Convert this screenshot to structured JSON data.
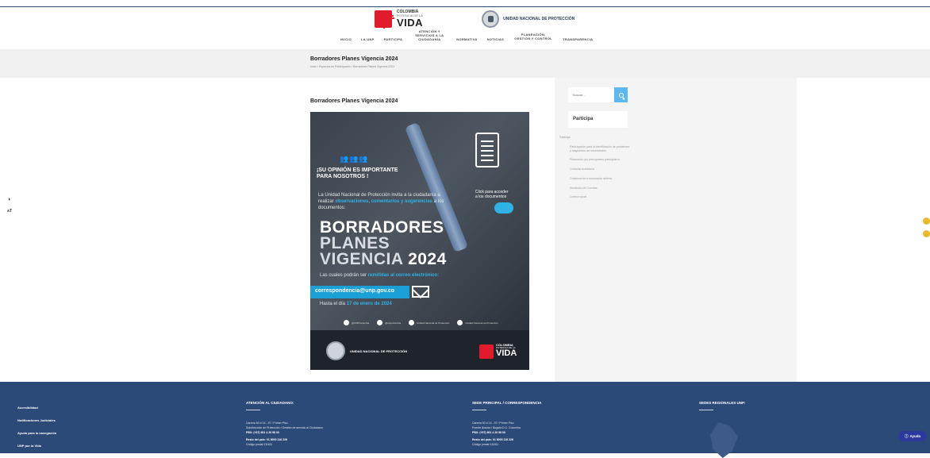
{
  "header": {
    "colombia_logo": {
      "line1": "COLOMBIA",
      "line2": "POTENCIA DE LA",
      "line3": "VIDA"
    },
    "unp_logo": {
      "text": "UNIDAD NACIONAL DE PROTECCIÓN"
    },
    "nav": [
      {
        "label": "INICIO"
      },
      {
        "label": "LA UNP"
      },
      {
        "label": "PARTICIPA"
      },
      {
        "label": "ATENCIÓN Y SERVICIOS A LA CIUDADANÍA"
      },
      {
        "label": "NORMATIVA"
      },
      {
        "label": "NOTICIAS"
      },
      {
        "label": "PLANEACIÓN, GESTIÓN Y CONTROL"
      },
      {
        "label": "TRANSPARENCIA"
      }
    ]
  },
  "pagehead": {
    "title": "Borradores Planes Vigencia 2024",
    "breadcrumb": "Inicio  /  Espacios de Participación  /  Borradores Planes Vigencia 2024"
  },
  "content": {
    "title": "Borradores Planes Vigencia 2024"
  },
  "poster": {
    "headline_l1": "¡SU OPINIÓN ES IMPORTANTE",
    "headline_l2": "PARA NOSOTROS !",
    "intro_a": "La Unidad Nacional de Protección invita a la ciudadanía a realizar ",
    "intro_hl": "observaciones, comentarios y sugerencias",
    "intro_b": " a los documentos:",
    "click_l1": "Click para acceder",
    "click_l2": "a los documentos",
    "big_l1": "BORRADORES",
    "big_l2": "PLANES",
    "big_l3a": "VIGENCIA ",
    "big_l3b": "2024",
    "remit_a": "Las cuales podrán ser ",
    "remit_hl": "remitidas al correo electrónico:",
    "email": "correspondencia@unp.gov.co",
    "until_a": "Hasta el día ",
    "until_hl": "17 de enero de 2024",
    "social": [
      "@UNPColombia",
      "@unpcolombia",
      "Unidad Nacional de Protección",
      "Unidad Nacional de Protección"
    ],
    "footer_unp": "UNIDAD NACIONAL DE PROTECCIÓN",
    "footer_col_1": "COLOMBIA",
    "footer_col_2": "POTENCIA DE LA",
    "footer_col_3": "VIDA"
  },
  "sidebar": {
    "search_placeholder": "Buscar...",
    "widget_title": "Participa",
    "list_label": "Participa",
    "items": [
      "Participación para la identificación de problemas y diagnóstico de necesidades",
      "Planeación y/o presupuesto participativo",
      "Consulta ciudadana",
      "Colaboración e innovación abierta",
      "Rendición de Cuentas",
      "Control social"
    ]
  },
  "access_tools": {
    "contrast": "◑",
    "text_size": "ᴀT"
  },
  "footer": {
    "links": [
      "Accesibilidad",
      "Notificaciones Judiciales",
      "Ayuda para la navegación",
      "UNP por la Vida"
    ],
    "col1": {
      "heading": "ATENCIÓN AL CIUDADANO:",
      "l1": "Carrera 63 # 14 - 97 / Primer Piso",
      "l2": "Subdirección de Protección / Gestión de servicio al Ciudadano",
      "l3": "PBX: (+57) 601 4 26 98 00",
      "l4": "Resto del país: 01 8000 116 226",
      "l5": "Código postal 111611"
    },
    "col2": {
      "heading": "SEDE PRINCIPAL / CORRESPONDENCIA",
      "l1": "Carrera 63 # 14 - 97 / Primer Piso",
      "l2": "Puente Aranda / Bogotá D.C. Colombia",
      "l3": "PBX: (+57) 601 4 26 98 00",
      "l4": "Resto del país: 01 8000 116 226",
      "l5": "Código postal 111611"
    },
    "col3": {
      "heading": "SEDES REGIONALES UNP:"
    },
    "help_label": "Ayuda"
  }
}
